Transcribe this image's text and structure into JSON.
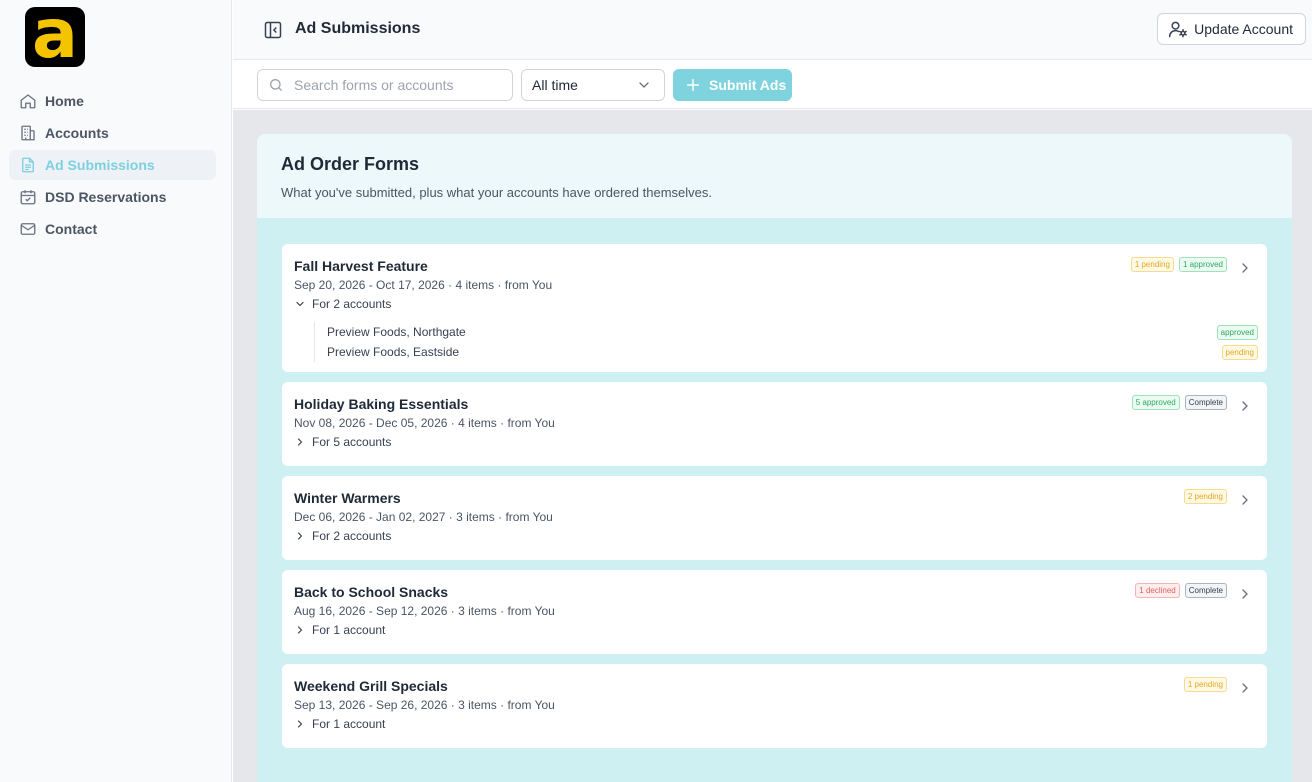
{
  "app": {
    "logo_letter": "a"
  },
  "sidebar": {
    "items": [
      {
        "label": "Home",
        "icon": "home-icon"
      },
      {
        "label": "Accounts",
        "icon": "building-icon"
      },
      {
        "label": "Ad Submissions",
        "icon": "document-icon",
        "active": true
      },
      {
        "label": "DSD Reservations",
        "icon": "calendar-check-icon"
      },
      {
        "label": "Contact",
        "icon": "mail-icon"
      }
    ]
  },
  "header": {
    "title": "Ad Submissions",
    "update_account_label": "Update Account"
  },
  "toolbar": {
    "search_placeholder": "Search forms or accounts",
    "search_value": "",
    "time_filter": "All time",
    "submit_label": "Submit Ads"
  },
  "panel": {
    "title": "Ad Order Forms",
    "subtitle": "What you've submitted, plus what your accounts have ordered themselves."
  },
  "forms": [
    {
      "title": "Fall Harvest Feature",
      "meta": "Sep 20, 2026 - Oct 17, 2026 · 4 items · from You",
      "accounts_label": "For 2 accounts",
      "expanded": true,
      "badges": [
        {
          "text": "1 pending",
          "status": "pending"
        },
        {
          "text": "1 approved",
          "status": "approved"
        }
      ],
      "accounts": [
        {
          "name": "Preview Foods, Northgate",
          "status": "approved"
        },
        {
          "name": "Preview Foods, Eastside",
          "status": "pending"
        }
      ]
    },
    {
      "title": "Holiday Baking Essentials",
      "meta": "Nov 08, 2026 - Dec 05, 2026 · 4 items · from You",
      "accounts_label": "For 5 accounts",
      "badges": [
        {
          "text": "5 approved",
          "status": "approved"
        },
        {
          "text": "Complete",
          "status": "complete"
        }
      ]
    },
    {
      "title": "Winter Warmers",
      "meta": "Dec 06, 2026 - Jan 02, 2027 · 3 items · from You",
      "accounts_label": "For 2 accounts",
      "badges": [
        {
          "text": "2 pending",
          "status": "pending"
        }
      ]
    },
    {
      "title": "Back to School Snacks",
      "meta": "Aug 16, 2026 - Sep 12, 2026 · 3 items · from You",
      "accounts_label": "For 1 account",
      "badges": [
        {
          "text": "1 declined",
          "status": "declined"
        },
        {
          "text": "Complete",
          "status": "complete"
        }
      ]
    },
    {
      "title": "Weekend Grill Specials",
      "meta": "Sep 13, 2026 - Sep 26, 2026 · 3 items · from You",
      "accounts_label": "For 1 account",
      "badges": [
        {
          "text": "1 pending",
          "status": "pending"
        }
      ]
    }
  ],
  "colors": {
    "accent": "#7cd0df",
    "panel_bg": "#cff0f3",
    "logo_yellow": "#f5c400"
  }
}
